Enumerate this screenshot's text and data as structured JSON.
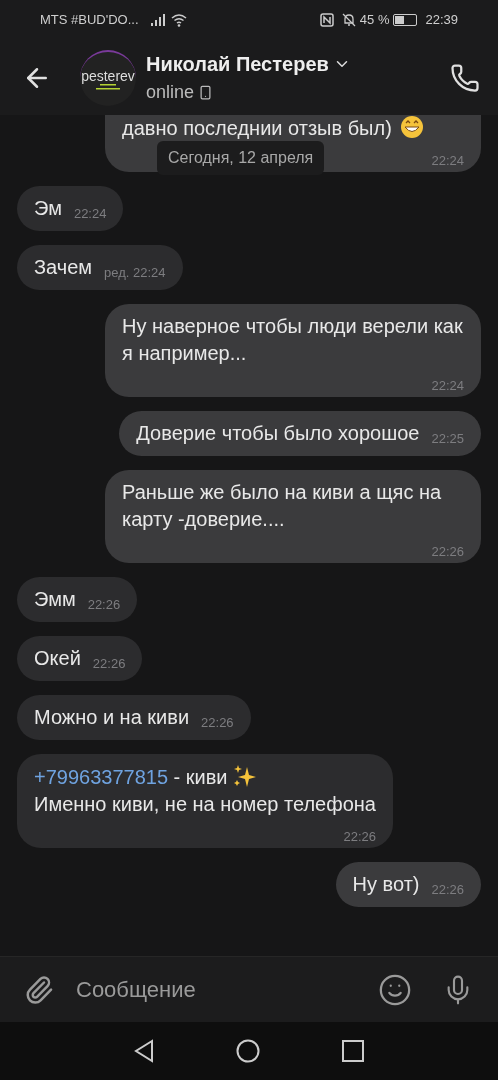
{
  "status_bar": {
    "carrier": "MTS #BUD'DO...",
    "battery_text": "45 %",
    "time": "22:39"
  },
  "header": {
    "name": "Николай Пестерев",
    "status": "online",
    "avatar_title": "pesterev"
  },
  "date_divider": "Сегодня, 12 апреля",
  "messages": [
    {
      "outgoing": true,
      "text": "давно последнии отзыв был)",
      "time": "22:24",
      "grin_emoji": true,
      "clipped": true
    },
    {
      "outgoing": false,
      "text": "Эм",
      "time": "22:24"
    },
    {
      "outgoing": false,
      "text": "Зачем",
      "time": "22:24",
      "edited": "ред."
    },
    {
      "outgoing": true,
      "text": "Ну наверное чтобы люди верели как я например...",
      "time": "22:24"
    },
    {
      "outgoing": true,
      "text": "Доверие чтобы было хорошое",
      "time": "22:25"
    },
    {
      "outgoing": true,
      "text": "Раньше же было на киви а щяс на карту -доверие....",
      "time": "22:26"
    },
    {
      "outgoing": false,
      "text": "Эмм",
      "time": "22:26"
    },
    {
      "outgoing": false,
      "text": "Окей",
      "time": "22:26"
    },
    {
      "outgoing": false,
      "text": "Можно и на киви",
      "time": "22:26"
    },
    {
      "outgoing": false,
      "link": "+79963377815",
      "text": " - киви",
      "sparkle_emoji": true,
      "text2": "Именно киви, не на номер телефона",
      "time": "22:26"
    },
    {
      "outgoing": true,
      "text": "Ну вот)",
      "time": "22:26"
    }
  ],
  "composer": {
    "placeholder": "Сообщение"
  }
}
